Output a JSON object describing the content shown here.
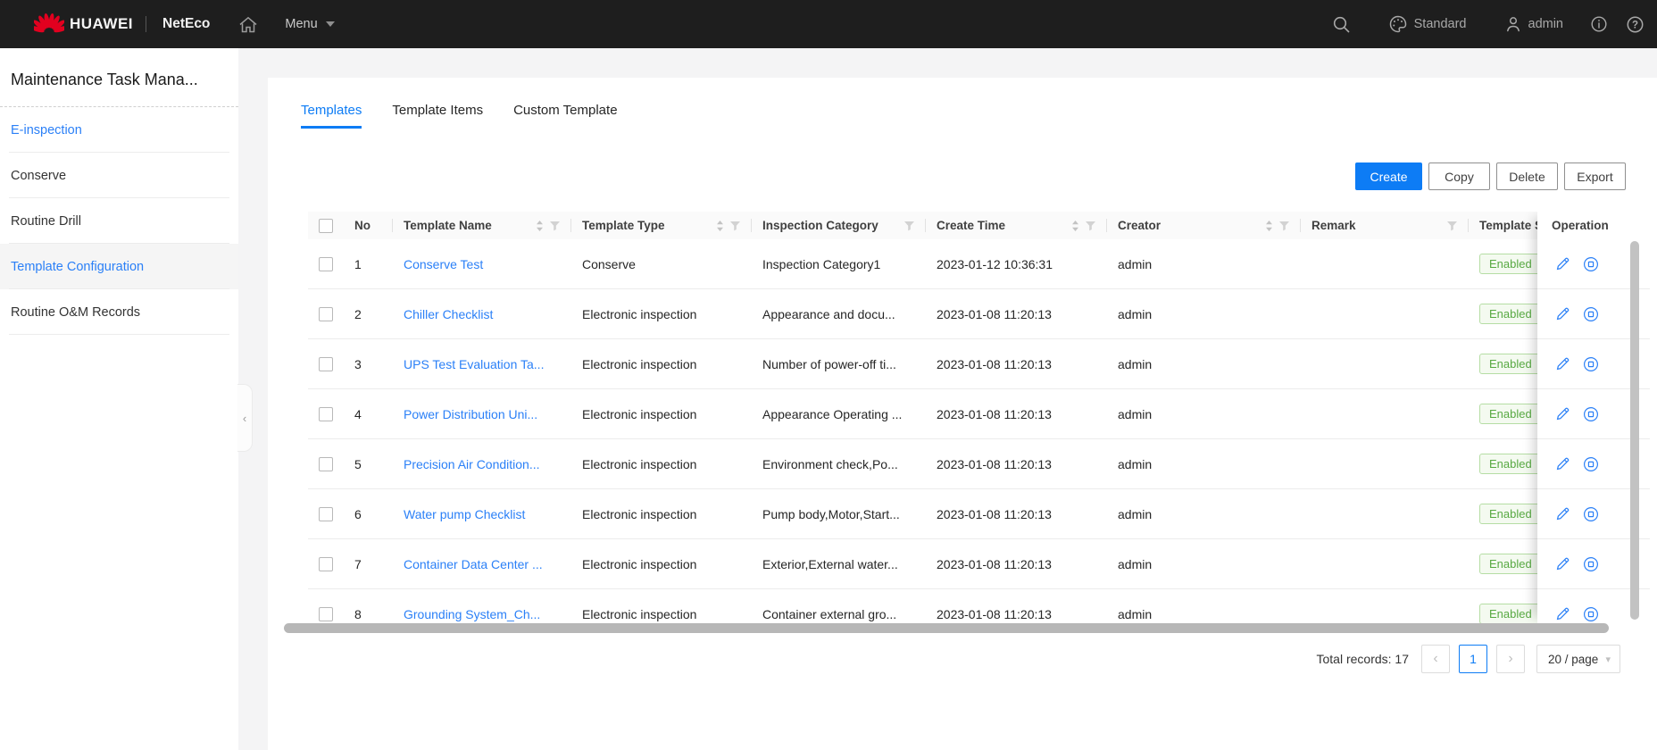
{
  "topbar": {
    "brand": "HUAWEI",
    "product": "NetEco",
    "menu_label": "Menu",
    "theme_label": "Standard",
    "user_label": "admin"
  },
  "sidebar": {
    "title": "Maintenance Task Mana...",
    "items": [
      {
        "label": "E-inspection",
        "style": "link",
        "active": false
      },
      {
        "label": "Conserve",
        "style": "normal",
        "active": false
      },
      {
        "label": "Routine Drill",
        "style": "normal",
        "active": false
      },
      {
        "label": "Template Configuration",
        "style": "link",
        "active": true
      },
      {
        "label": "Routine O&M Records",
        "style": "normal",
        "active": false
      }
    ]
  },
  "tabs": [
    {
      "label": "Templates",
      "active": true
    },
    {
      "label": "Template Items",
      "active": false
    },
    {
      "label": "Custom Template",
      "active": false
    }
  ],
  "toolbar": {
    "create_label": "Create",
    "copy_label": "Copy",
    "delete_label": "Delete",
    "export_label": "Export"
  },
  "table": {
    "columns": [
      {
        "label": "No",
        "sort": false,
        "filter": false
      },
      {
        "label": "Template Name",
        "sort": true,
        "filter": true
      },
      {
        "label": "Template Type",
        "sort": true,
        "filter": true
      },
      {
        "label": "Inspection Category",
        "sort": false,
        "filter": true
      },
      {
        "label": "Create Time",
        "sort": true,
        "filter": true
      },
      {
        "label": "Creator",
        "sort": true,
        "filter": true
      },
      {
        "label": "Remark",
        "sort": false,
        "filter": true
      },
      {
        "label": "Template S",
        "sort": false,
        "filter": false
      }
    ],
    "operation_header": "Operation",
    "rows": [
      {
        "no": "1",
        "name": "Conserve Test",
        "type": "Conserve",
        "category": "Inspection Category1",
        "create_time": "2023-01-12 10:36:31",
        "creator": "admin",
        "remark": "",
        "status": "Enabled"
      },
      {
        "no": "2",
        "name": "Chiller Checklist",
        "type": "Electronic inspection",
        "category": "Appearance and docu...",
        "create_time": "2023-01-08 11:20:13",
        "creator": "admin",
        "remark": "",
        "status": "Enabled"
      },
      {
        "no": "3",
        "name": "UPS Test Evaluation Ta...",
        "type": "Electronic inspection",
        "category": "Number of power-off ti...",
        "create_time": "2023-01-08 11:20:13",
        "creator": "admin",
        "remark": "",
        "status": "Enabled"
      },
      {
        "no": "4",
        "name": "Power Distribution Uni...",
        "type": "Electronic inspection",
        "category": "Appearance Operating ...",
        "create_time": "2023-01-08 11:20:13",
        "creator": "admin",
        "remark": "",
        "status": "Enabled"
      },
      {
        "no": "5",
        "name": "Precision Air Condition...",
        "type": "Electronic inspection",
        "category": "Environment check,Po...",
        "create_time": "2023-01-08 11:20:13",
        "creator": "admin",
        "remark": "",
        "status": "Enabled"
      },
      {
        "no": "6",
        "name": "Water pump Checklist",
        "type": "Electronic inspection",
        "category": "Pump body,Motor,Start...",
        "create_time": "2023-01-08 11:20:13",
        "creator": "admin",
        "remark": "",
        "status": "Enabled"
      },
      {
        "no": "7",
        "name": "Container Data Center ...",
        "type": "Electronic inspection",
        "category": "Exterior,External water...",
        "create_time": "2023-01-08 11:20:13",
        "creator": "admin",
        "remark": "",
        "status": "Enabled"
      },
      {
        "no": "8",
        "name": "Grounding System_Ch...",
        "type": "Electronic inspection",
        "category": "Container external gro...",
        "create_time": "2023-01-08 11:20:13",
        "creator": "admin",
        "remark": "",
        "status": "Enabled"
      }
    ]
  },
  "pagination": {
    "total_label": "Total records: 17",
    "page": "1",
    "page_size_label": "20 / page"
  },
  "colors": {
    "accent": "#0d7cf5",
    "link": "#2b80f7",
    "badge_text": "#58a942",
    "topbar_bg": "#1e1e1e"
  }
}
